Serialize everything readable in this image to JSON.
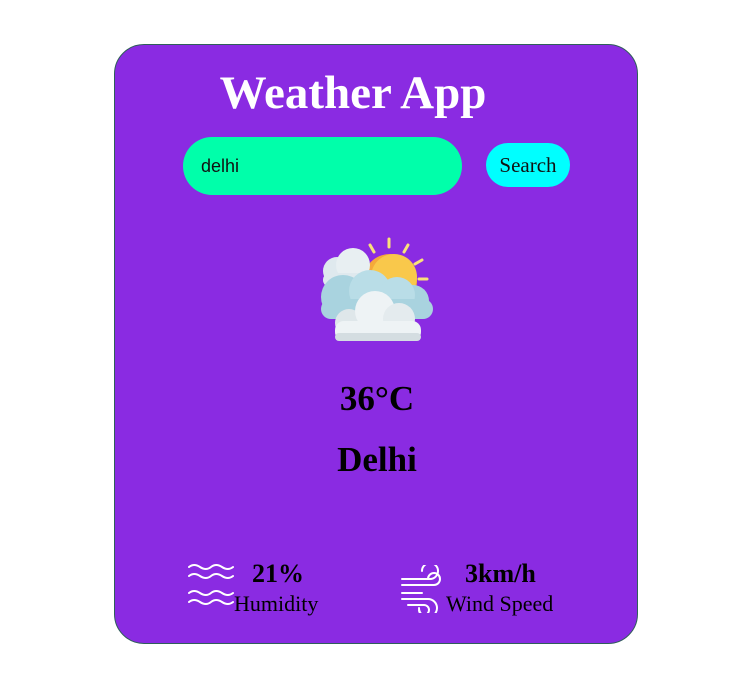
{
  "app": {
    "title": "Weather App"
  },
  "search": {
    "value": "delhi",
    "button_label": "Search"
  },
  "weather": {
    "icon": "sun-behind-clouds-icon",
    "temperature": "36°C",
    "city": "Delhi"
  },
  "details": {
    "humidity": {
      "icon": "waves-icon",
      "value": "21%",
      "label": "Humidity"
    },
    "wind": {
      "icon": "wind-icon",
      "value": "3km/h",
      "label": "Wind Speed"
    }
  },
  "colors": {
    "card_background": "#8a2be2",
    "input_background": "#00ffaa",
    "button_background": "#00ffff",
    "title_text": "#ffffff"
  }
}
